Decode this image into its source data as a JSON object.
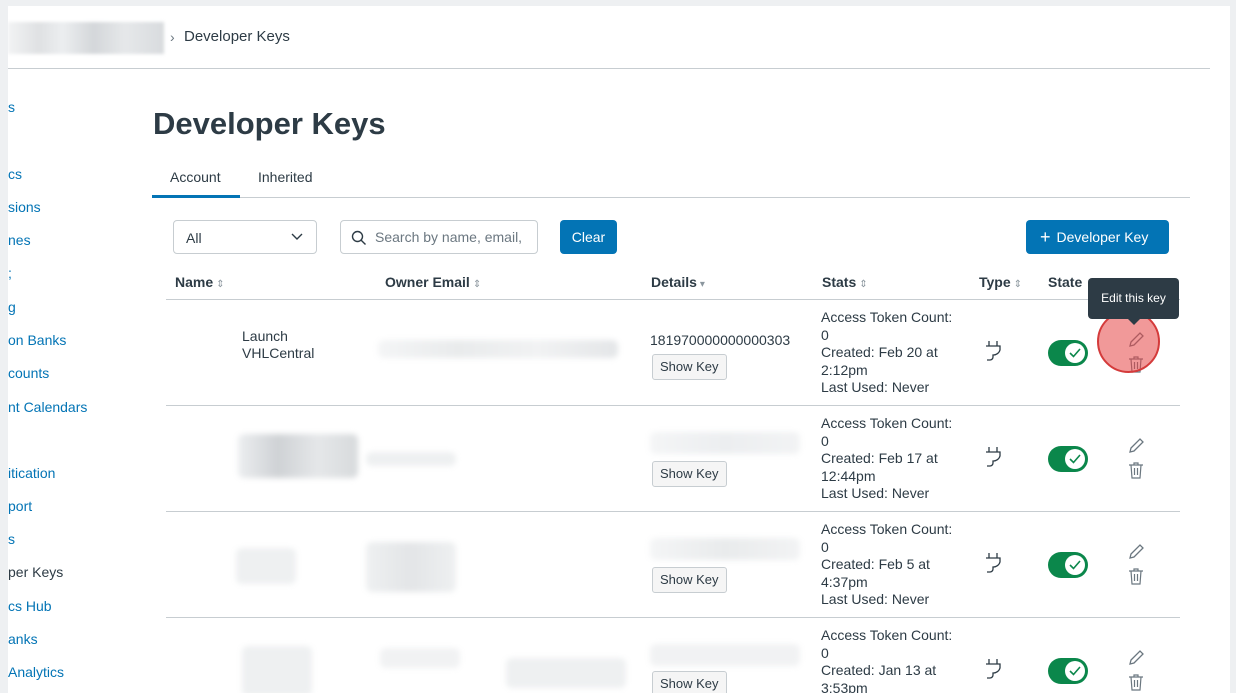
{
  "breadcrumb": {
    "current": "Developer Keys"
  },
  "nav": {
    "items": [
      {
        "label": "s"
      },
      {
        "label": "cs"
      },
      {
        "label": "sions"
      },
      {
        "label": "nes"
      },
      {
        "label": ";"
      },
      {
        "label": "g"
      },
      {
        "label": "on Banks"
      },
      {
        "label": "counts"
      },
      {
        "label": "nt Calendars"
      },
      {
        "label": "itication"
      },
      {
        "label": "port"
      },
      {
        "label": "s"
      },
      {
        "label": "per Keys"
      },
      {
        "label": "cs Hub"
      },
      {
        "label": "anks"
      },
      {
        "label": "Analytics"
      }
    ]
  },
  "page": {
    "title": "Developer Keys"
  },
  "tabs": [
    {
      "label": "Account"
    },
    {
      "label": "Inherited"
    }
  ],
  "filters": {
    "select_value": "All",
    "search_placeholder": "Search by name, email,",
    "clear_label": "Clear",
    "add_label": "Developer Key"
  },
  "table": {
    "headers": [
      "Name",
      "Owner Email",
      "Details",
      "Stats",
      "Type",
      "State"
    ],
    "show_key_label": "Show Key",
    "rows": [
      {
        "name_line1": "Launch",
        "name_line2": "VHLCentral",
        "details_id": "181970000000000303",
        "stats_count_label": "Access Token Count:",
        "stats_count": "0",
        "stats_created": "Created: Feb 20 at",
        "stats_time": "2:12pm",
        "stats_last": "Last Used: Never",
        "state_on": true
      },
      {
        "name_line1": "",
        "name_line2": "",
        "details_id": "",
        "stats_count_label": "Access Token Count:",
        "stats_count": "0",
        "stats_created": "Created: Feb 17 at",
        "stats_time": "12:44pm",
        "stats_last": "Last Used: Never",
        "state_on": true
      },
      {
        "name_line1": "",
        "name_line2": "",
        "details_id": "",
        "stats_count_label": "Access Token Count:",
        "stats_count": "0",
        "stats_created": "Created: Feb 5 at",
        "stats_time": "4:37pm",
        "stats_last": "Last Used: Never",
        "state_on": true
      },
      {
        "name_line1": "",
        "name_line2": "",
        "details_id": "",
        "stats_count_label": "Access Token Count:",
        "stats_count": "0",
        "stats_created": "Created: Jan 13 at",
        "stats_time": "3:53pm",
        "stats_last": "",
        "state_on": true
      }
    ]
  },
  "tooltip": {
    "text": "Edit this key"
  },
  "colors": {
    "accent": "#0374b5",
    "toggle_on": "#0b874b",
    "tooltip_bg": "#2d3b45",
    "highlight": "#d43b3b"
  },
  "icons": [
    "chevron-right-icon",
    "chevron-down-icon",
    "search-icon",
    "plus-icon",
    "sort-icon",
    "plug-icon",
    "check-icon",
    "pencil-icon",
    "trash-icon"
  ]
}
